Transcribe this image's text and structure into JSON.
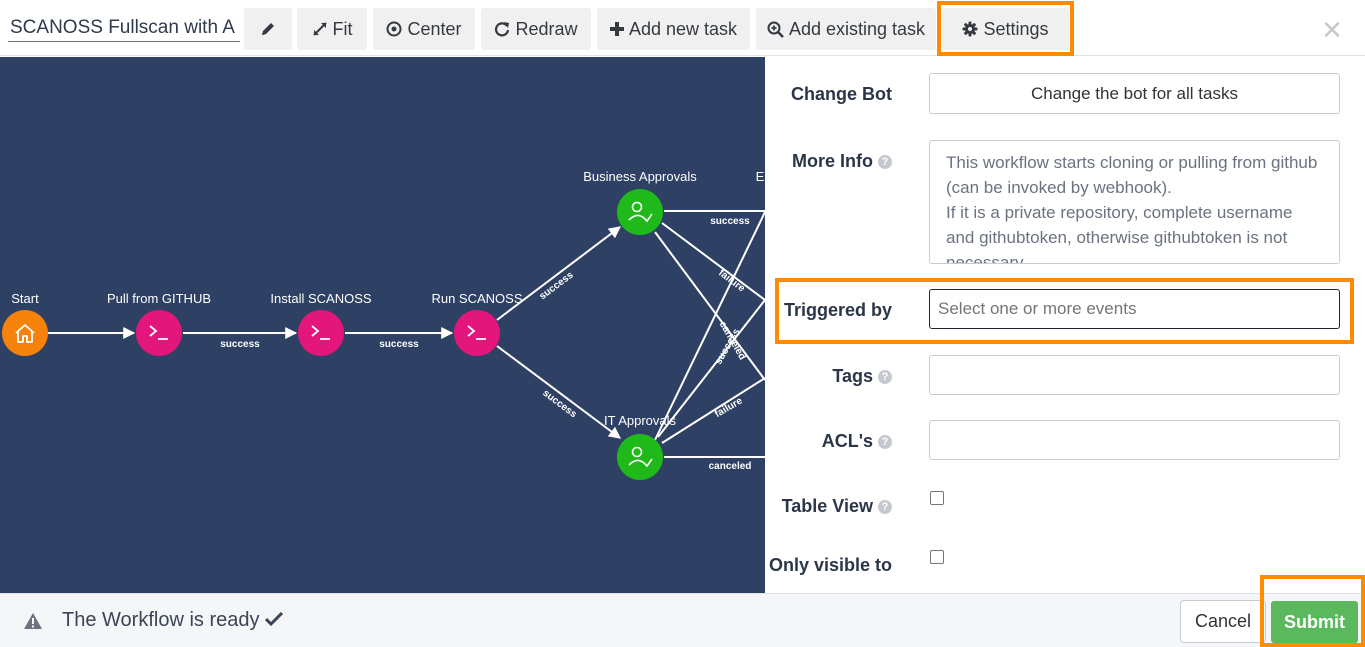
{
  "toolbar": {
    "workflow_name": "SCANOSS Fullscan with A",
    "fit_label": "Fit",
    "center_label": "Center",
    "redraw_label": "Redraw",
    "add_new_task_label": "Add new task",
    "add_existing_task_label": "Add existing task",
    "settings_label": "Settings"
  },
  "graph": {
    "nodes": [
      {
        "label": "Start",
        "type": "start",
        "color": "#f5820b"
      },
      {
        "label": "Pull from GITHUB",
        "type": "task",
        "color": "#e3167c"
      },
      {
        "label": "Install SCANOSS",
        "type": "task",
        "color": "#e3167c"
      },
      {
        "label": "Run SCANOSS",
        "type": "task",
        "color": "#e3167c"
      },
      {
        "label": "Business Approvals",
        "type": "approval",
        "color": "#1fba1a"
      },
      {
        "label": "IT Approvals",
        "type": "approval",
        "color": "#1fba1a"
      },
      {
        "label": "E",
        "type": "partial"
      }
    ],
    "edge_labels": {
      "pull_install": "success",
      "install_run": "success",
      "run_business": "success",
      "run_it": "success",
      "business_out": "success",
      "business_failure": "failure",
      "business_canceled": "canceled",
      "it_success": "success",
      "it_failure": "failure",
      "it_canceled": "canceled"
    }
  },
  "settings": {
    "change_bot_label": "Change Bot",
    "change_bot_button": "Change the bot for all tasks",
    "more_info_label": "More Info",
    "more_info_text": "This workflow starts cloning or pulling from github (can be invoked by webhook).\nIf it is a private repository, complete username and githubtoken, otherwise githubtoken is not necessary",
    "triggered_by_label": "Triggered by",
    "triggered_by_placeholder": "Select one or more events",
    "tags_label": "Tags",
    "acls_label": "ACL's",
    "table_view_label": "Table View",
    "only_visible_label": "Only visible to"
  },
  "footer": {
    "status": "The Workflow is ready",
    "cancel_label": "Cancel",
    "submit_label": "Submit"
  },
  "colors": {
    "canvas_bg": "#2f4065",
    "highlight": "#ff8c00",
    "submit_green": "#5cb85c"
  }
}
